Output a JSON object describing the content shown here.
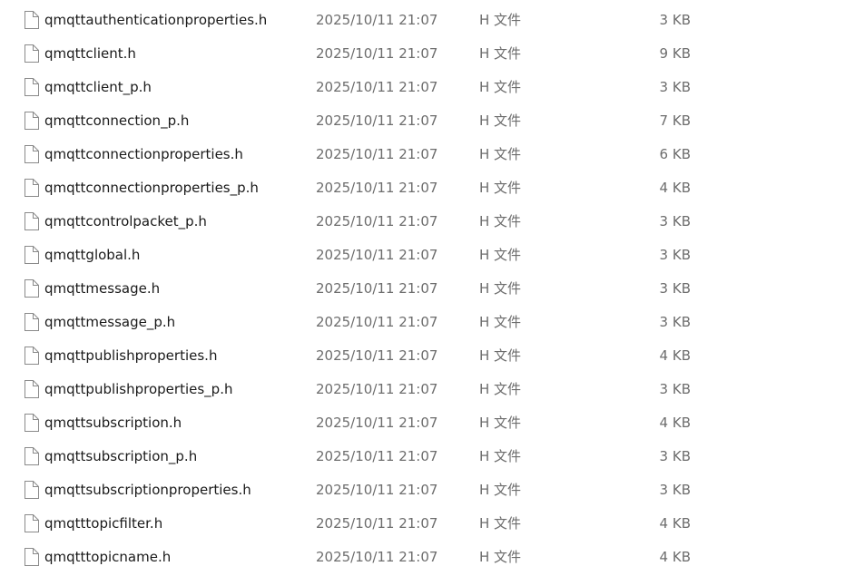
{
  "files": [
    {
      "name": "qmqttauthenticationproperties.h",
      "modified": "2025/10/11 21:07",
      "type": "H 文件",
      "size": "3 KB",
      "icon": "file-icon"
    },
    {
      "name": "qmqttclient.h",
      "modified": "2025/10/11 21:07",
      "type": "H 文件",
      "size": "9 KB",
      "icon": "file-icon"
    },
    {
      "name": "qmqttclient_p.h",
      "modified": "2025/10/11 21:07",
      "type": "H 文件",
      "size": "3 KB",
      "icon": "file-icon"
    },
    {
      "name": "qmqttconnection_p.h",
      "modified": "2025/10/11 21:07",
      "type": "H 文件",
      "size": "7 KB",
      "icon": "file-icon"
    },
    {
      "name": "qmqttconnectionproperties.h",
      "modified": "2025/10/11 21:07",
      "type": "H 文件",
      "size": "6 KB",
      "icon": "file-icon"
    },
    {
      "name": "qmqttconnectionproperties_p.h",
      "modified": "2025/10/11 21:07",
      "type": "H 文件",
      "size": "4 KB",
      "icon": "file-icon"
    },
    {
      "name": "qmqttcontrolpacket_p.h",
      "modified": "2025/10/11 21:07",
      "type": "H 文件",
      "size": "3 KB",
      "icon": "file-icon"
    },
    {
      "name": "qmqttglobal.h",
      "modified": "2025/10/11 21:07",
      "type": "H 文件",
      "size": "3 KB",
      "icon": "file-icon"
    },
    {
      "name": "qmqttmessage.h",
      "modified": "2025/10/11 21:07",
      "type": "H 文件",
      "size": "3 KB",
      "icon": "file-icon"
    },
    {
      "name": "qmqttmessage_p.h",
      "modified": "2025/10/11 21:07",
      "type": "H 文件",
      "size": "3 KB",
      "icon": "file-icon"
    },
    {
      "name": "qmqttpublishproperties.h",
      "modified": "2025/10/11 21:07",
      "type": "H 文件",
      "size": "4 KB",
      "icon": "file-icon"
    },
    {
      "name": "qmqttpublishproperties_p.h",
      "modified": "2025/10/11 21:07",
      "type": "H 文件",
      "size": "3 KB",
      "icon": "file-icon"
    },
    {
      "name": "qmqttsubscription.h",
      "modified": "2025/10/11 21:07",
      "type": "H 文件",
      "size": "4 KB",
      "icon": "file-icon"
    },
    {
      "name": "qmqttsubscription_p.h",
      "modified": "2025/10/11 21:07",
      "type": "H 文件",
      "size": "3 KB",
      "icon": "file-icon"
    },
    {
      "name": "qmqttsubscriptionproperties.h",
      "modified": "2025/10/11 21:07",
      "type": "H 文件",
      "size": "3 KB",
      "icon": "file-icon"
    },
    {
      "name": "qmqtttopicfilter.h",
      "modified": "2025/10/11 21:07",
      "type": "H 文件",
      "size": "4 KB",
      "icon": "file-icon"
    },
    {
      "name": "qmqtttopicname.h",
      "modified": "2025/10/11 21:07",
      "type": "H 文件",
      "size": "4 KB",
      "icon": "file-icon"
    }
  ],
  "colors": {
    "name_text": "#1a1a1a",
    "meta_text": "#6d6d6d",
    "icon_stroke": "#8a8a8a",
    "background": "#ffffff"
  }
}
